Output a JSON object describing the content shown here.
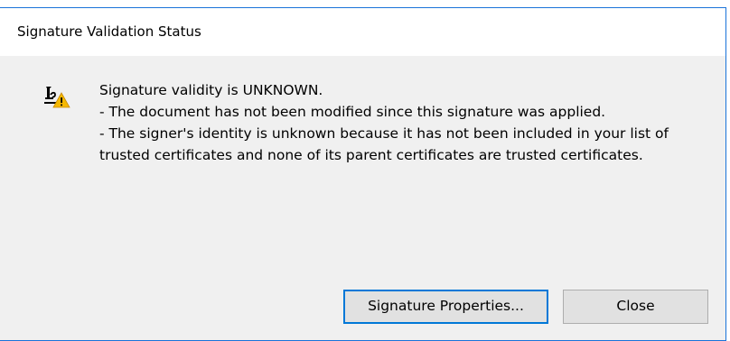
{
  "dialog": {
    "title": "Signature Validation Status",
    "icon": "signature-warning-icon",
    "message": {
      "lines": [
        "Signature validity is UNKNOWN.",
        "- The document has not been modified since this signature was applied.",
        "- The signer's identity is unknown because it has not been included in your list of",
        "trusted certificates and none of its parent certificates are trusted certificates."
      ]
    },
    "buttons": {
      "properties_label": "Signature Properties...",
      "close_label": "Close"
    }
  },
  "colors": {
    "accent_border": "#1a73d9",
    "focus_border": "#0078d7",
    "dialog_background": "#f0f0f0",
    "button_face": "#e1e1e1",
    "warning_yellow": "#f5b800"
  }
}
